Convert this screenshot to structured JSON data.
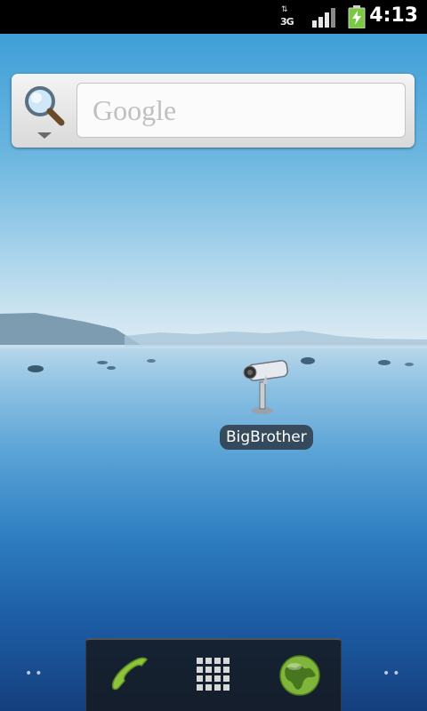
{
  "status_bar": {
    "network_type": "3G",
    "data_arrows": "⇅",
    "time": "4:13",
    "icons": [
      "signal-icon",
      "battery-charging-icon"
    ]
  },
  "search": {
    "placeholder": "Google",
    "icon": "magnifier-icon"
  },
  "desktop": {
    "apps": [
      {
        "label": "BigBrother",
        "icon": "security-camera-icon"
      }
    ]
  },
  "page_indicator": {
    "left": "••",
    "right": "••"
  },
  "dock": {
    "items": [
      {
        "name": "phone",
        "icon": "phone-icon"
      },
      {
        "name": "all-apps",
        "icon": "app-grid-icon"
      },
      {
        "name": "browser",
        "icon": "globe-icon"
      }
    ]
  },
  "colors": {
    "status_bar_bg": "#000000",
    "battery_green": "#7ac943",
    "search_widget_bg": "#e8e8e8"
  }
}
